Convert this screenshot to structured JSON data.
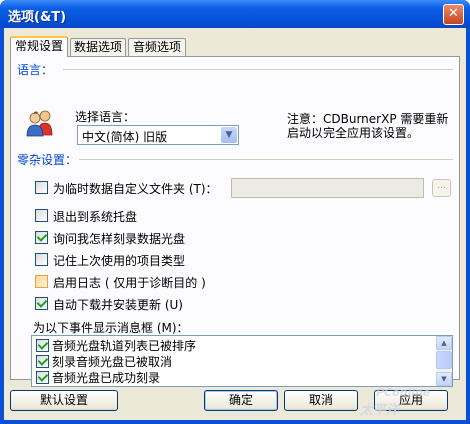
{
  "window": {
    "title": "选项(&T)",
    "close_glyph": "✕"
  },
  "tabs": [
    {
      "label": "常规设置",
      "active": true
    },
    {
      "label": "数据选项",
      "active": false
    },
    {
      "label": "音频选项",
      "active": false
    }
  ],
  "language": {
    "section_label": "语言：",
    "select_label": "选择语言：",
    "selected": "中文(简体) 旧版",
    "notice_line1": "注意：CDBurnerXP 需要重新",
    "notice_line2": "启动以完全应用该设置。"
  },
  "misc": {
    "section_label": "零杂设置：",
    "temp_folder": {
      "label": "为临时数据自定义文件夹 (T)：",
      "checked": false,
      "path": "",
      "browse": "..."
    },
    "options": [
      {
        "label": "退出到系统托盘",
        "checked": false
      },
      {
        "label": "询问我怎样刻录数据光盘",
        "checked": true
      },
      {
        "label": "记住上次使用的项目类型",
        "checked": false
      },
      {
        "label": "启用日志 ( 仅用于诊断目的 )",
        "checked": false
      },
      {
        "label": "自动下载并安装更新 (U)",
        "checked": true
      }
    ]
  },
  "events": {
    "label": "为以下事件显示消息框 (M)：",
    "items": [
      {
        "label": "音频光盘轨道列表已被排序",
        "checked": true
      },
      {
        "label": "刻录音频光盘已被取消",
        "checked": true
      },
      {
        "label": "音频光盘已成功刻录",
        "checked": true
      }
    ]
  },
  "buttons": {
    "default_settings": "默认设置",
    "ok": "确定",
    "cancel": "取消",
    "apply": "应用"
  },
  "watermark": {
    "main": "PConline",
    "sub": "太平洋"
  },
  "colors": {
    "title_bar": "#0551d8",
    "section_label": "#0046d5",
    "face": "#ece9d8",
    "check": "#21a121",
    "tab_highlight": "#ffc83c"
  }
}
